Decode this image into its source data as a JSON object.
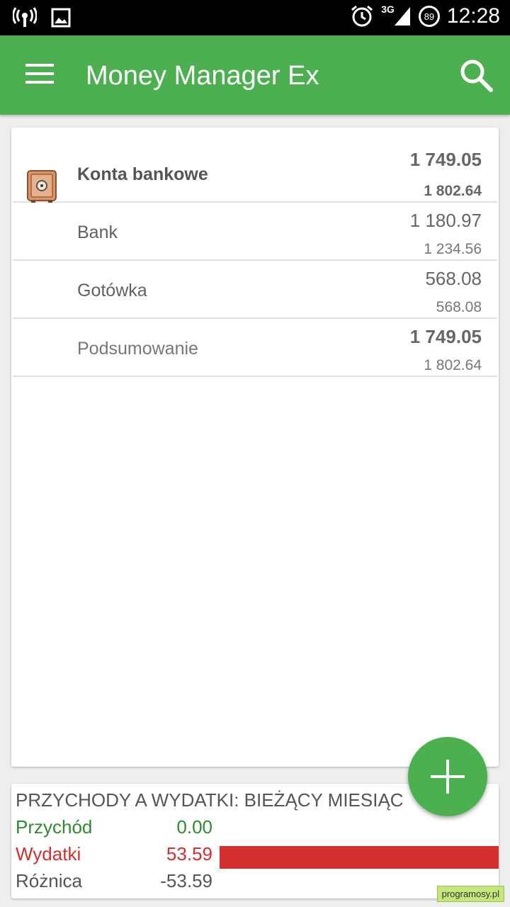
{
  "status_bar": {
    "time": "12:28",
    "network": "3G",
    "battery": "89",
    "icons": [
      "hotspot-icon",
      "image-icon",
      "alarm-icon",
      "signal-icon",
      "battery-icon"
    ]
  },
  "app_bar": {
    "title": "Money Manager Ex",
    "menu_icon": "hamburger-menu-icon",
    "search_icon": "search-icon",
    "color": "#4caf50"
  },
  "accounts": {
    "group": {
      "label": "Konta bankowe",
      "balance": "1 749.05",
      "reconciled": "1 802.64",
      "icon": "safe-icon"
    },
    "items": [
      {
        "label": "Bank",
        "balance": "1 180.97",
        "reconciled": "1 234.56"
      },
      {
        "label": "Gotówka",
        "balance": "568.08",
        "reconciled": "568.08"
      }
    ],
    "total": {
      "label": "Podsumowanie",
      "balance": "1 749.05",
      "reconciled": "1 802.64"
    }
  },
  "summary": {
    "title": "PRZYCHODY A WYDATKI: BIEŻĄCY MIESIĄC",
    "rows": [
      {
        "label": "Przychód",
        "value": "0.00",
        "color": "#2e8b2e"
      },
      {
        "label": "Wydatki",
        "value": "53.59",
        "color": "#d32f2f",
        "bar_fraction": 1.0
      },
      {
        "label": "Różnica",
        "value": "-53.59",
        "color": "#555555"
      }
    ]
  },
  "fab": {
    "icon": "plus-icon"
  },
  "watermark": "programosy.pl"
}
